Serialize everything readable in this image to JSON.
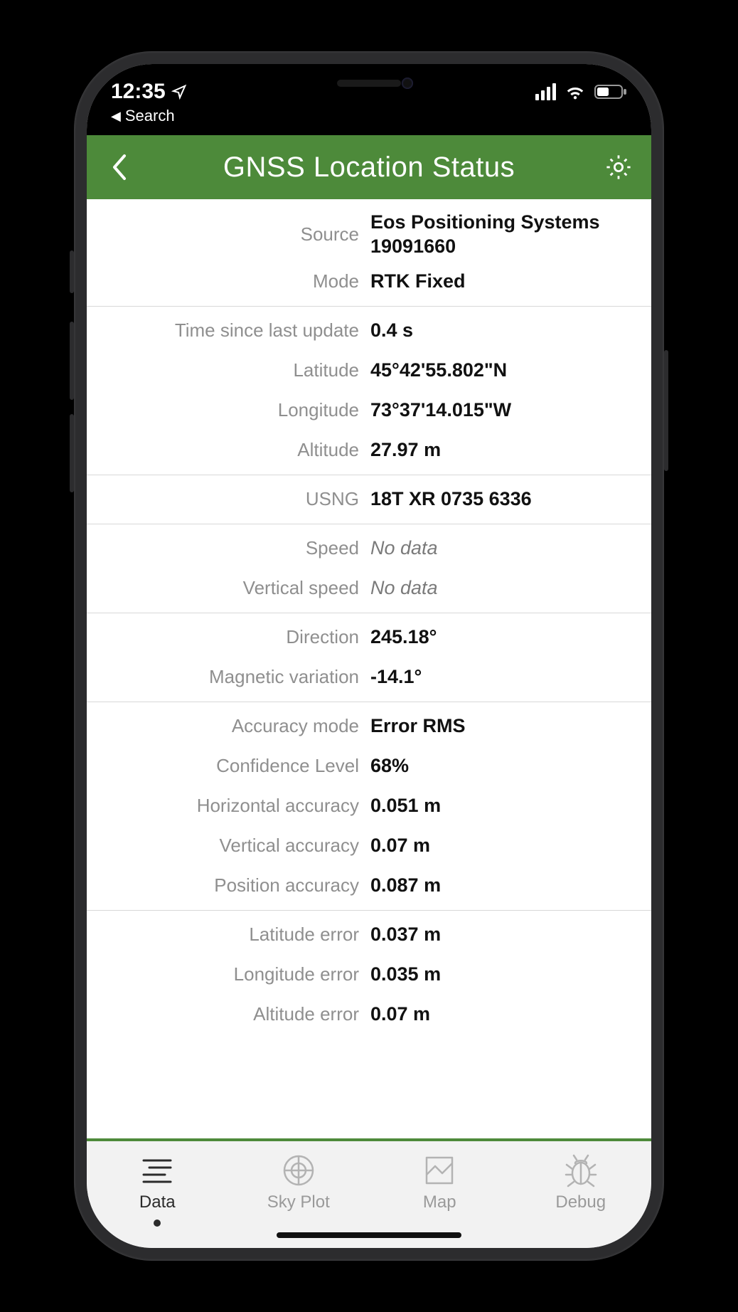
{
  "status": {
    "time": "12:35",
    "breadcrumb": "Search"
  },
  "header": {
    "title": "GNSS Location Status"
  },
  "labels": {
    "source": "Source",
    "mode": "Mode",
    "tsu": "Time since last update",
    "lat": "Latitude",
    "lon": "Longitude",
    "alt": "Altitude",
    "usng": "USNG",
    "speed": "Speed",
    "vspeed": "Vertical speed",
    "dir": "Direction",
    "magvar": "Magnetic variation",
    "accmode": "Accuracy mode",
    "conf": "Confidence Level",
    "hacc": "Horizontal accuracy",
    "vacc": "Vertical accuracy",
    "pacc": "Position accuracy",
    "laterr": "Latitude error",
    "lonerr": "Longitude error",
    "alterr": "Altitude error"
  },
  "values": {
    "source": "Eos Positioning Systems 19091660",
    "mode": "RTK Fixed",
    "tsu": "0.4 s",
    "lat": "45°42'55.802\"N",
    "lon": "73°37'14.015\"W",
    "alt": "27.97 m",
    "usng": "18T XR 0735 6336",
    "speed": "No data",
    "vspeed": "No data",
    "dir": "245.18°",
    "magvar": "-14.1°",
    "accmode": "Error RMS",
    "conf": "68%",
    "hacc": "0.051 m",
    "vacc": "0.07 m",
    "pacc": "0.087 m",
    "laterr": "0.037 m",
    "lonerr": "0.035 m",
    "alterr": "0.07 m"
  },
  "tabs": {
    "data": "Data",
    "skyplot": "Sky Plot",
    "map": "Map",
    "debug": "Debug"
  }
}
